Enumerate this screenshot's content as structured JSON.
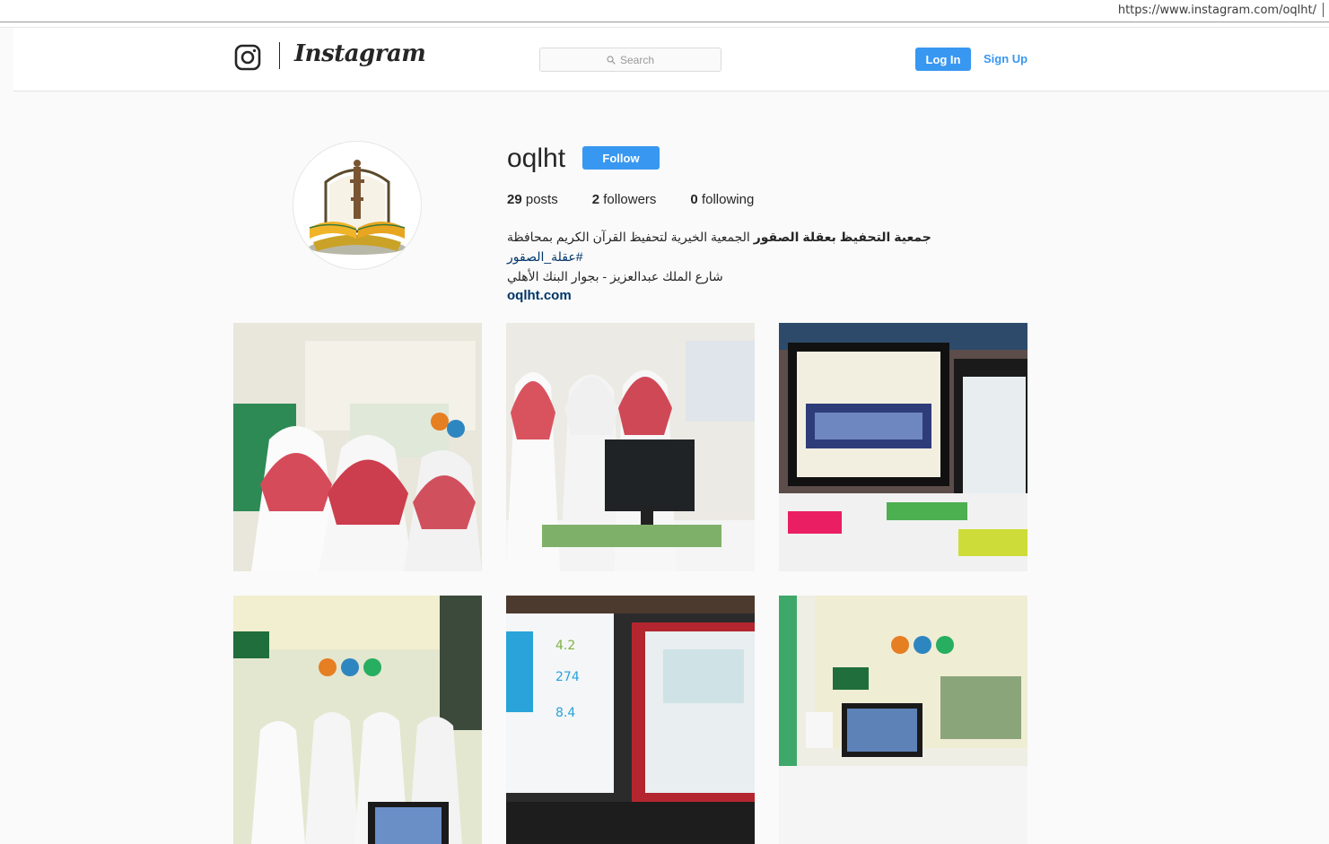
{
  "browser": {
    "url": "https://www.instagram.com/oqlht/"
  },
  "nav": {
    "brand": "Instagram",
    "search_placeholder": "Search",
    "login_label": "Log In",
    "signup_label": "Sign Up",
    "accent": "#3897f0"
  },
  "profile": {
    "username": "oqlht",
    "follow_label": "Follow",
    "posts_count": "29",
    "posts_label": "posts",
    "followers_count": "2",
    "followers_label": "followers",
    "following_count": "0",
    "following_label": "following",
    "bio_name": "جمعية التحفيظ بعقلة الصقور",
    "bio_text": " الجمعية الخيرية لتحفيظ القرآن الكريم بمحافظة ",
    "bio_hashtag": "#عقلة_الصقور",
    "bio_line2": "شارع الملك عبدالعزيز - بجوار البنك الأهلي",
    "website": "oqlht.com"
  },
  "posts": [
    {
      "icon": "post-photo"
    },
    {
      "icon": "post-photo"
    },
    {
      "icon": "post-photo"
    },
    {
      "icon": "post-photo"
    },
    {
      "icon": "post-photo"
    },
    {
      "icon": "post-photo"
    }
  ]
}
